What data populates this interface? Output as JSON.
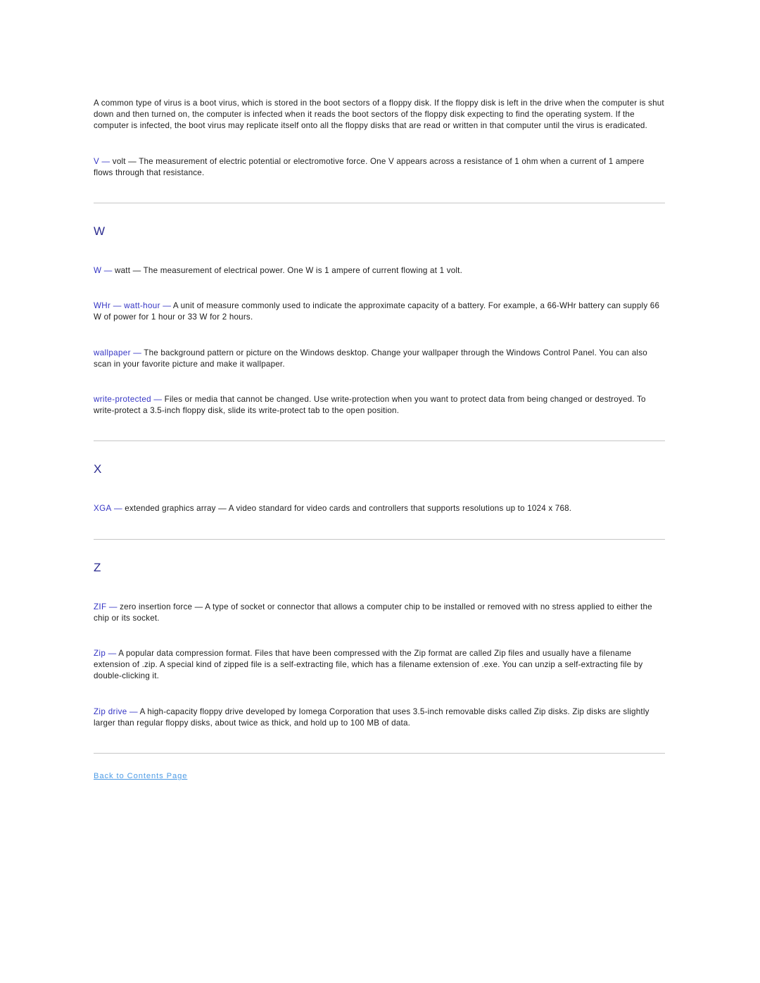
{
  "document": {
    "type": "glossary-page",
    "colors": {
      "body_text": "#1c1c1c",
      "term": "#3434c4",
      "section_letter": "#2b2b8f",
      "link": "#4d9be6",
      "rule": "#c6c6c6",
      "background": "#ffffff"
    }
  },
  "intro": {
    "virus_note": "A common type of virus is a boot virus, which is stored in the boot sectors of a floppy disk. If the floppy disk is left in the drive when the computer is shut down and then turned on, the computer is infected when it reads the boot sectors of the floppy disk expecting to find the operating system. If the computer is infected, the boot virus may replicate itself onto all the floppy disks that are read or written in that computer until the virus is eradicated."
  },
  "entries_v": [
    {
      "term": "V",
      "dash": " — ",
      "definition": "volt — The measurement of electric potential or electromotive force. One V appears across a resistance of 1 ohm when a current of 1 ampere flows through that resistance."
    }
  ],
  "sections": [
    {
      "letter": "W",
      "entries": [
        {
          "term": "W",
          "dash": " — ",
          "definition": "watt — The measurement of electrical power. One W is 1 ampere of current flowing at 1 volt."
        },
        {
          "term": "WHr — watt-hour",
          "dash": " — ",
          "definition": "A unit of measure commonly used to indicate the approximate capacity of a battery. For example, a 66-WHr battery can supply 66 W of power for 1 hour or 33 W for 2 hours."
        },
        {
          "term": "wallpaper",
          "dash": " — ",
          "definition": "The background pattern or picture on the Windows desktop. Change your wallpaper through the Windows Control Panel. You can also scan in your favorite picture and make it wallpaper."
        },
        {
          "term": "write-protected",
          "dash": " — ",
          "definition": "Files or media that cannot be changed. Use write-protection when you want to protect data from being changed or destroyed. To write-protect a 3.5-inch floppy disk, slide its write-protect tab to the open position."
        }
      ]
    },
    {
      "letter": "X",
      "entries": [
        {
          "term": "XGA",
          "dash": " — ",
          "definition": "extended graphics array — A video standard for video cards and controllers that supports resolutions up to 1024 x 768."
        }
      ]
    },
    {
      "letter": "Z",
      "entries": [
        {
          "term": "ZIF",
          "dash": " — ",
          "definition": "zero insertion force — A type of socket or connector that allows a computer chip to be installed or removed with no stress applied to either the chip or its socket."
        },
        {
          "term": "Zip",
          "dash": " — ",
          "definition": "A popular data compression format. Files that have been compressed with the Zip format are called Zip files and usually have a filename extension of .zip. A special kind of zipped file is a self-extracting file, which has a filename extension of .exe. You can unzip a self-extracting file by double-clicking it."
        },
        {
          "term": "Zip drive",
          "dash": " — ",
          "definition": "A high-capacity floppy drive developed by Iomega Corporation that uses 3.5-inch removable disks called Zip disks. Zip disks are slightly larger than regular floppy disks, about twice as thick, and hold up to 100 MB of data."
        }
      ]
    }
  ],
  "footer": {
    "back_link": "Back to Contents Page"
  }
}
